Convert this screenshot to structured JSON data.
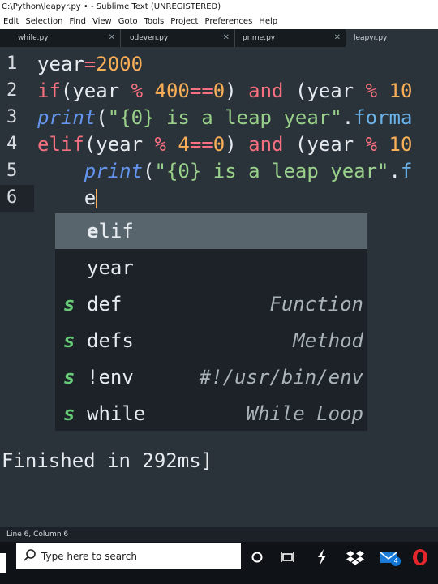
{
  "window": {
    "title": "C:\\Python\\leapyr.py • - Sublime Text (UNREGISTERED)"
  },
  "menu": [
    "Edit",
    "Selection",
    "Find",
    "View",
    "Goto",
    "Tools",
    "Project",
    "Preferences",
    "Help"
  ],
  "tabs": [
    {
      "label": "while.py",
      "active": false
    },
    {
      "label": "odeven.py",
      "active": false
    },
    {
      "label": "prime.py",
      "active": false
    },
    {
      "label": "leapyr.py",
      "active": true
    }
  ],
  "editor": {
    "line_numbers": [
      "1",
      "2",
      "3",
      "4",
      "5",
      "6"
    ],
    "current_line": 6,
    "lines": [
      [
        {
          "t": "year",
          "c": "v"
        },
        {
          "t": "=",
          "c": "o"
        },
        {
          "t": "2000",
          "c": "n"
        }
      ],
      [
        {
          "t": "if",
          "c": "k"
        },
        {
          "t": "(year ",
          "c": "v"
        },
        {
          "t": "%",
          "c": "o"
        },
        {
          "t": " ",
          "c": "v"
        },
        {
          "t": "400",
          "c": "n"
        },
        {
          "t": "==",
          "c": "o"
        },
        {
          "t": "0",
          "c": "n"
        },
        {
          "t": ") ",
          "c": "v"
        },
        {
          "t": "and",
          "c": "k"
        },
        {
          "t": " (year ",
          "c": "v"
        },
        {
          "t": "%",
          "c": "o"
        },
        {
          "t": " ",
          "c": "v"
        },
        {
          "t": "10",
          "c": "n"
        }
      ],
      [
        {
          "t": "print",
          "c": "f"
        },
        {
          "t": "(",
          "c": "v"
        },
        {
          "t": "\"{0} is a leap year\"",
          "c": "s"
        },
        {
          "t": ".",
          "c": "v"
        },
        {
          "t": "forma",
          "c": "m"
        }
      ],
      [
        {
          "t": "elif",
          "c": "k"
        },
        {
          "t": "(year ",
          "c": "v"
        },
        {
          "t": "%",
          "c": "o"
        },
        {
          "t": " ",
          "c": "v"
        },
        {
          "t": "4",
          "c": "n"
        },
        {
          "t": "==",
          "c": "o"
        },
        {
          "t": "0",
          "c": "n"
        },
        {
          "t": ") ",
          "c": "v"
        },
        {
          "t": "and",
          "c": "k"
        },
        {
          "t": " (year ",
          "c": "v"
        },
        {
          "t": "%",
          "c": "o"
        },
        {
          "t": " ",
          "c": "v"
        },
        {
          "t": "10",
          "c": "n"
        }
      ],
      [
        {
          "t": "    ",
          "c": "v"
        },
        {
          "t": "print",
          "c": "f"
        },
        {
          "t": "(",
          "c": "v"
        },
        {
          "t": "\"{0} is a leap year\"",
          "c": "s"
        },
        {
          "t": ".",
          "c": "v"
        },
        {
          "t": "f",
          "c": "m"
        }
      ],
      [
        {
          "t": "    e",
          "c": "v"
        }
      ]
    ]
  },
  "autocomplete": {
    "items": [
      {
        "badge": "",
        "match": "e",
        "rest": "lif",
        "hint": "",
        "selected": true
      },
      {
        "badge": "",
        "match": "",
        "rest": "year",
        "hint": "",
        "selected": false
      },
      {
        "badge": "s",
        "match": "",
        "rest": "def",
        "hint": "Function",
        "selected": false
      },
      {
        "badge": "s",
        "match": "",
        "rest": "defs",
        "hint": "Method",
        "selected": false
      },
      {
        "badge": "s",
        "match": "",
        "rest": "!env",
        "hint": "#!/usr/bin/env",
        "selected": false
      },
      {
        "badge": "s",
        "match": "",
        "rest": "while",
        "hint": "While Loop",
        "selected": false
      }
    ]
  },
  "output": {
    "text": "Finished in 292ms]"
  },
  "statusbar": {
    "position": "Line 6, Column 6"
  },
  "taskbar": {
    "search_placeholder": "Type here to search",
    "mail_badge": "4",
    "icons": [
      "start-icon",
      "search-icon",
      "cortana-icon",
      "task-view-icon",
      "sublime-text-icon",
      "dropbox-icon",
      "mail-icon",
      "opera-icon"
    ]
  }
}
